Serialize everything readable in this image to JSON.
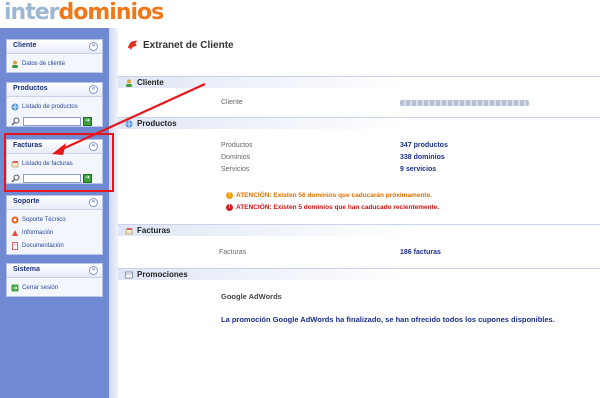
{
  "brand": {
    "logo_part1": "inter",
    "logo_part2": "dominios"
  },
  "sidebar": {
    "panels": [
      {
        "title": "Cliente",
        "items": [
          {
            "label": "Datos de cliente",
            "icon": "user-icon"
          }
        ]
      },
      {
        "title": "Productos",
        "items": [
          {
            "label": "Listado de productos",
            "icon": "network-icon"
          }
        ],
        "search": true
      },
      {
        "title": "Facturas",
        "items": [
          {
            "label": "Listado de facturas",
            "icon": "invoice-icon"
          }
        ],
        "search": true
      },
      {
        "title": "Soporte",
        "items": [
          {
            "label": "Soporte Técnico",
            "icon": "support-icon"
          },
          {
            "label": "Información",
            "icon": "info-icon"
          },
          {
            "label": "Documentación",
            "icon": "document-icon"
          }
        ]
      },
      {
        "title": "Sistema",
        "items": [
          {
            "label": "Cerrar sesión",
            "icon": "logout-icon"
          }
        ]
      }
    ]
  },
  "main": {
    "title": "Extranet de Cliente",
    "sections": {
      "cliente": "Cliente",
      "productos": "Productos",
      "facturas": "Facturas",
      "promociones": "Promociones"
    },
    "cliente": {
      "label": "Cliente"
    },
    "productos": {
      "rows": [
        {
          "label": "Productos",
          "value": "347 productos"
        },
        {
          "label": "Dominios",
          "value": "338 dominios"
        },
        {
          "label": "Servicios",
          "value": "9 servicios"
        }
      ],
      "alerts": [
        {
          "type": "warning",
          "text": "ATENCIÓN: Existen 56 dominios que caducarán próximamente."
        },
        {
          "type": "error",
          "text": "ATENCIÓN: Existen 5 dominios que han caducado recientemente."
        }
      ]
    },
    "facturas": {
      "label": "Facturas",
      "value": "186 facturas"
    },
    "promociones": {
      "title": "Google AdWords",
      "text": "La promoción Google AdWords ha finalizado, se han ofrecido todos los cupones disponibles."
    }
  },
  "colors": {
    "sidebar_bg": "#6f89d2",
    "accent_orange": "#f07818",
    "link_blue": "#1a2f8a",
    "warning": "#e07000",
    "error": "#d01010",
    "annotation_red": "#e8151b"
  }
}
